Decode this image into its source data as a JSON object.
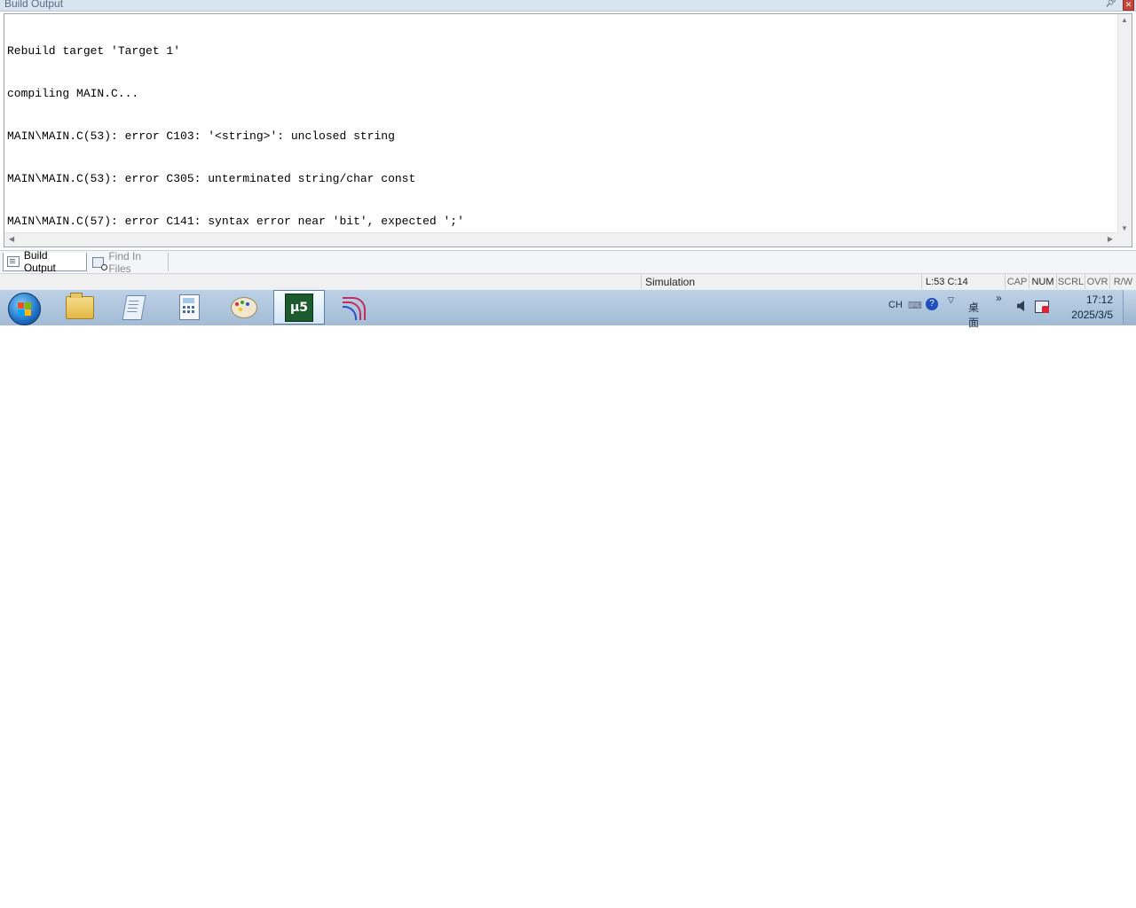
{
  "panel": {
    "title": "Build Output"
  },
  "output": {
    "lines": [
      "Rebuild target 'Target 1'",
      "compiling MAIN.C...",
      "MAIN\\MAIN.C(53): error C103: '<string>': unclosed string",
      "MAIN\\MAIN.C(53): error C305: unterminated string/char const",
      "MAIN\\MAIN.C(57): error C141: syntax error near 'bit', expected ';'"
    ]
  },
  "tabs": [
    {
      "label": "Build Output",
      "icon": "build-output-icon",
      "active": true
    },
    {
      "label": "Find In Files",
      "icon": "find-in-files-icon",
      "active": false
    }
  ],
  "status": {
    "mode": "Simulation",
    "position": "L:53 C:14",
    "keys": [
      "CAP",
      "NUM",
      "SCRL",
      "OVR",
      "R/W"
    ]
  },
  "taskbar": {
    "apps": [
      {
        "name": "file-explorer-icon"
      },
      {
        "name": "notepad-icon"
      },
      {
        "name": "calculator-icon"
      },
      {
        "name": "paint-icon"
      },
      {
        "name": "keil-uvision-icon",
        "active": true
      },
      {
        "name": "stc-isp-icon"
      }
    ],
    "tray": {
      "lang": "CH",
      "desktop": "桌面",
      "chevron": "»",
      "time": "17:12",
      "date": "2025/3/5"
    }
  }
}
